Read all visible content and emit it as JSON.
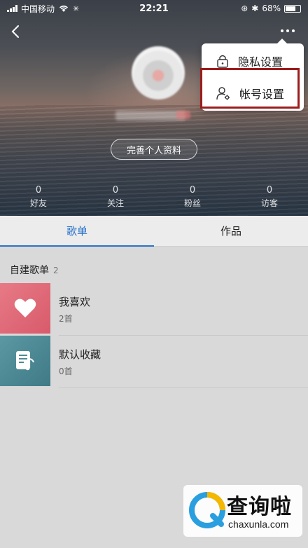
{
  "status_bar": {
    "carrier": "中国移动",
    "time": "22:21",
    "battery": "68%"
  },
  "profile": {
    "complete_profile_label": "完善个人资料",
    "stats": [
      {
        "value": "0",
        "label": "好友"
      },
      {
        "value": "0",
        "label": "关注"
      },
      {
        "value": "0",
        "label": "粉丝"
      },
      {
        "value": "0",
        "label": "访客"
      }
    ]
  },
  "menu": {
    "privacy_label": "隐私设置",
    "account_label": "帐号设置"
  },
  "tabs": [
    {
      "label": "歌单",
      "active": true
    },
    {
      "label": "作品",
      "active": false
    }
  ],
  "playlists": {
    "section_title": "自建歌单",
    "count": "2",
    "items": [
      {
        "title": "我喜欢",
        "sub": "2首",
        "cover_color": "#e26b78",
        "icon": "heart-icon"
      },
      {
        "title": "默认收藏",
        "sub": "0首",
        "cover_color": "#4e8a95",
        "icon": "music-note-list-icon"
      }
    ]
  },
  "watermark": {
    "title": "查询啦",
    "url": "chaxunla.com"
  },
  "colors": {
    "accent": "#2a73c9",
    "highlight_box": "#9b1d1d"
  }
}
